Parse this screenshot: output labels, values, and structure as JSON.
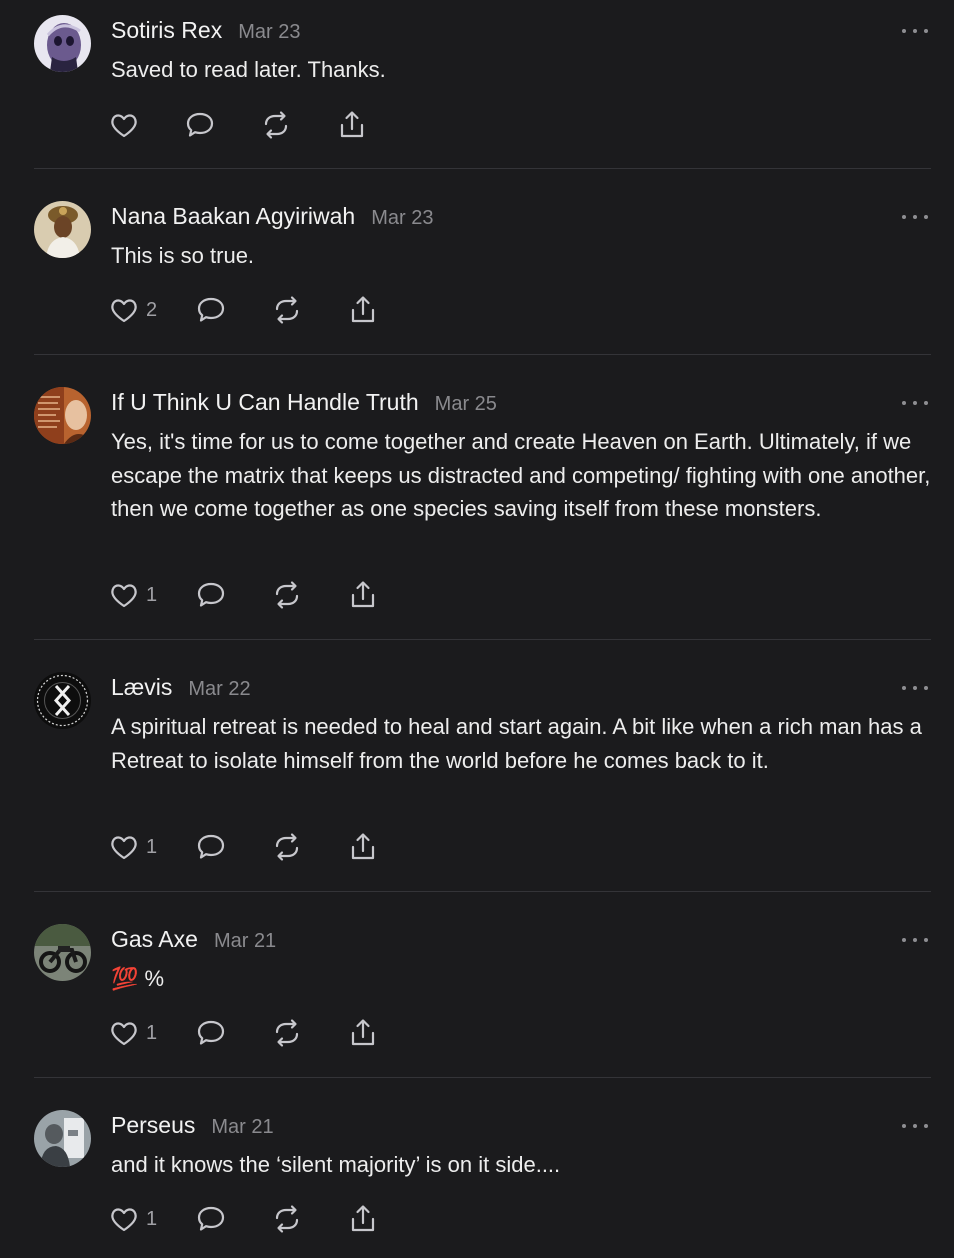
{
  "comments": [
    {
      "author": "Sotiris Rex",
      "date": "Mar 23",
      "text": "Saved to read later. Thanks.",
      "likes": ""
    },
    {
      "author": "Nana Baakan Agyiriwah",
      "date": "Mar 23",
      "text": "This is so true.",
      "likes": "2"
    },
    {
      "author": "If U Think U Can Handle Truth",
      "date": "Mar 25",
      "text": "Yes, it's time for us to come together and create Heaven on Earth. Ultimately, if we escape the matrix that keeps us distracted and competing/ fighting with one another, then we come together as one species saving itself from these monsters.",
      "likes": "1"
    },
    {
      "author": "Lævis",
      "date": "Mar 22",
      "text": "A spiritual retreat is needed to heal and start again. A bit like when a rich man has a Retreat to isolate himself from the world before he comes back to it.",
      "likes": "1"
    },
    {
      "author": "Gas Axe",
      "date": "Mar 21",
      "text": "💯 %",
      "likes": "1"
    },
    {
      "author": "Perseus",
      "date": "Mar 21",
      "text": "and it knows the ‘silent majority’ is on it side....",
      "likes": "1"
    }
  ],
  "icons": {
    "more": "more-horizontal-icon",
    "like": "heart-icon",
    "reply": "speech-bubble-icon",
    "restack": "restack-arrows-icon",
    "share": "share-upload-icon"
  },
  "colors": {
    "background": "#1b1b1d",
    "text": "#ededed",
    "muted": "#8a8a8e",
    "divider": "#343438"
  }
}
